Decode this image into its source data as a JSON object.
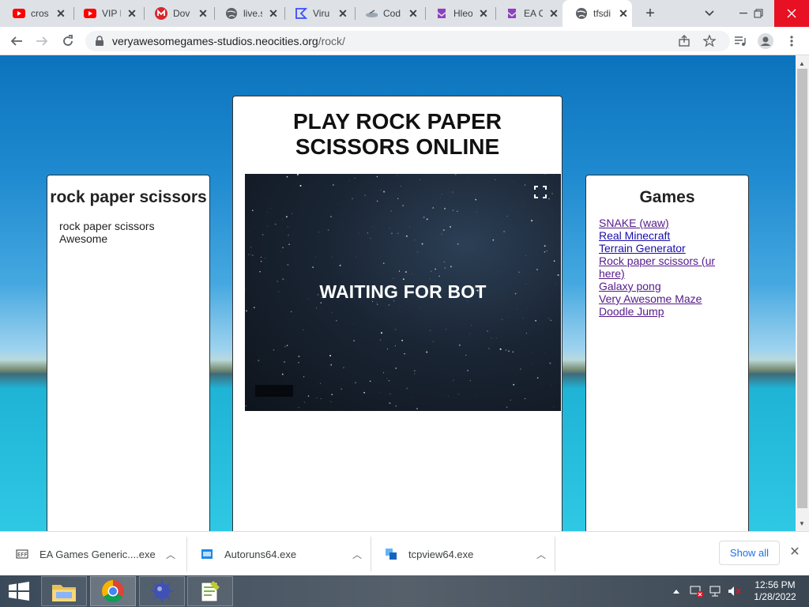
{
  "browser": {
    "tabs": [
      {
        "title": "cros",
        "icon": "youtube-icon"
      },
      {
        "title": "VIP I",
        "icon": "youtube-icon"
      },
      {
        "title": "Dov",
        "icon": "mega-icon"
      },
      {
        "title": "live.s",
        "icon": "globe-icon"
      },
      {
        "title": "Viru",
        "icon": "virustotal-icon"
      },
      {
        "title": "Cod",
        "icon": "codepen-icon"
      },
      {
        "title": "Hleo",
        "icon": "twitch-icon"
      },
      {
        "title": "EA C",
        "icon": "twitch-icon"
      },
      {
        "title": "tfsdi",
        "icon": "globe-icon",
        "active": true
      }
    ],
    "url_host": "veryawesomegames-studios.neocities.org",
    "url_path": "/rock/"
  },
  "page": {
    "left": {
      "title": "rock paper scissors",
      "text": "rock paper scissors Awesome"
    },
    "center": {
      "title": "PLAY ROCK PAPER SCISSORS ONLINE",
      "game_status": "WAITING FOR BOT"
    },
    "right": {
      "title": "Games",
      "links": [
        "SNAKE (waw)",
        "Real Minecraft",
        "Terrain Generator",
        "Rock paper scissors (ur here)",
        "Galaxy pong",
        "Very Awesome Maze",
        "Doodle Jump"
      ]
    }
  },
  "downloads": {
    "items": [
      "EA Games Generic....exe",
      "Autoruns64.exe",
      "tcpview64.exe"
    ],
    "show_all": "Show all"
  },
  "taskbar": {
    "time": "12:56 PM",
    "date": "1/28/2022"
  },
  "colors": {
    "link": "#1a0dab",
    "visited_link": "#551a8b",
    "close_button": "#e81123"
  }
}
